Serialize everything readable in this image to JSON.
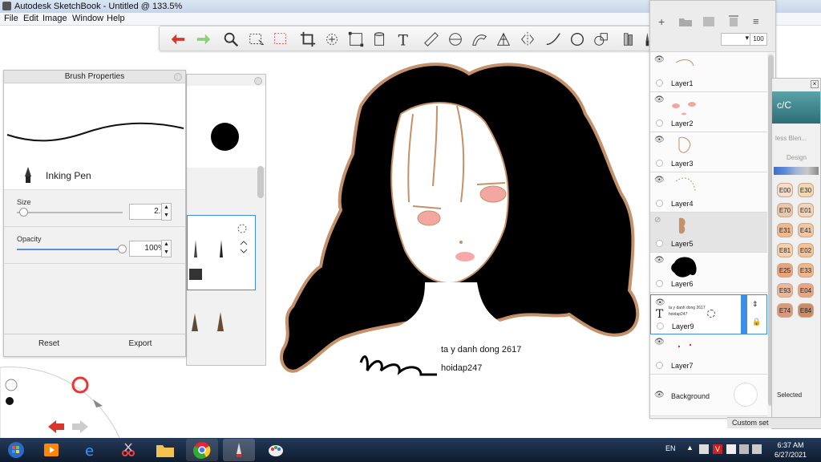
{
  "window": {
    "title": "Autodesk SketchBook - Untitled @ 133.5%",
    "menu": [
      "File",
      "Edit",
      "Image",
      "Window",
      "Help"
    ]
  },
  "toolbar": {
    "items": [
      "undo-icon",
      "redo-icon",
      "zoom-icon",
      "select-icon",
      "lasso-select-icon",
      "crop-icon",
      "transform-icon",
      "distort-icon",
      "fill-icon",
      "text-icon",
      "ruler-icon",
      "ellipse-guide-icon",
      "french-curve-icon",
      "perspective-icon",
      "symmetry-icon",
      "stroke-icon",
      "shape-icon",
      "shape-tools-icon",
      "copic-icon",
      "brush-library-icon",
      "color-wheel-icon",
      "layout-icon"
    ],
    "zoom_value": "100"
  },
  "brush_properties": {
    "title": "Brush Properties",
    "brush_name": "Inking Pen",
    "size_label": "Size",
    "size_value": "2.0",
    "opacity_label": "Opacity",
    "opacity_value": "100%",
    "size_fraction": 0.02,
    "opacity_fraction": 1.0,
    "reset_label": "Reset",
    "export_label": "Export"
  },
  "canvas_text": {
    "line1": "ta y danh dong 2617",
    "line2": "hoidap247"
  },
  "layers": {
    "items": [
      {
        "name": "Layer1",
        "visible": true
      },
      {
        "name": "Layer2",
        "visible": true
      },
      {
        "name": "Layer3",
        "visible": true
      },
      {
        "name": "Layer4",
        "visible": true
      },
      {
        "name": "Layer5",
        "visible": false
      },
      {
        "name": "Layer6",
        "visible": true
      },
      {
        "name": "Layer9",
        "visible": true,
        "selected": true
      },
      {
        "name": "Layer7",
        "visible": true
      }
    ],
    "background_label": "Background",
    "layer9_text": "ta y danh dong 2617 hoidap247"
  },
  "copic": {
    "header": "c/C",
    "subheader": "less Blen...",
    "design_label": "Design",
    "swatches": [
      "E00",
      "E30",
      "E70",
      "E01",
      "E31",
      "E41",
      "E81",
      "E02",
      "E25",
      "E33",
      "E93",
      "E04",
      "E74",
      "E84"
    ],
    "selected_label": "Selected",
    "custom_set_label": "Custom set"
  },
  "taskbar": {
    "language": "EN",
    "time": "6:37 AM",
    "date": "6/27/2021"
  },
  "colors": {
    "hair": "#000000",
    "outline": "#c4916a",
    "accent_blue": "#3d8ee6"
  }
}
